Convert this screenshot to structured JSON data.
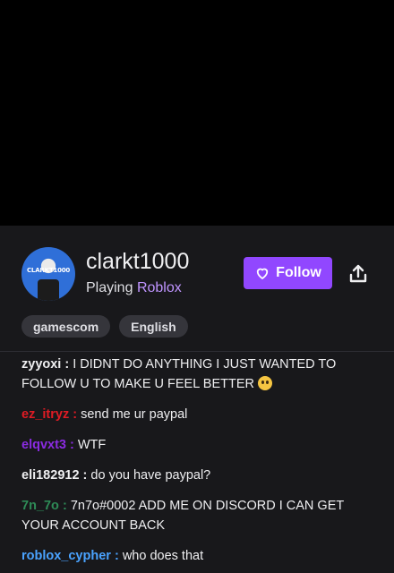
{
  "video": {},
  "channel": {
    "name": "clarkt1000",
    "playing_prefix": "Playing",
    "game": "Roblox",
    "avatar_text": "CLARKT1000",
    "follow_label": "Follow"
  },
  "tags": [
    "gamescom",
    "English"
  ],
  "chat": [
    {
      "user": "zyyoxi",
      "sep": " : ",
      "text": "I DIDNT DO ANYTHING I JUST WANTED TO FOLLOW U TO MAKE U FEEL BETTER",
      "color": "#efeff1",
      "emoji": "pleading-face"
    },
    {
      "user": "ez_itryz",
      "sep": " : ",
      "text": "send me ur paypal",
      "color": "#e01b24"
    },
    {
      "user": "elqvxt3",
      "sep": " : ",
      "text": "WTF",
      "color": "#8a2be2"
    },
    {
      "user": "eli182912",
      "sep": " : ",
      "text": "do you have paypal?",
      "color": "#efeff1"
    },
    {
      "user": "7n_7o",
      "sep": " : ",
      "text": "7n7o#0002 ADD ME ON DISCORD I CAN GET YOUR ACCOUNT BACK",
      "color": "#2e8b57"
    },
    {
      "user": "roblox_cypher",
      "sep": " : ",
      "text": "who does that",
      "color": "#4aa3ff"
    }
  ],
  "colors": {
    "accent": "#9147ff",
    "game_link": "#bf94ff",
    "background": "#18181b"
  }
}
